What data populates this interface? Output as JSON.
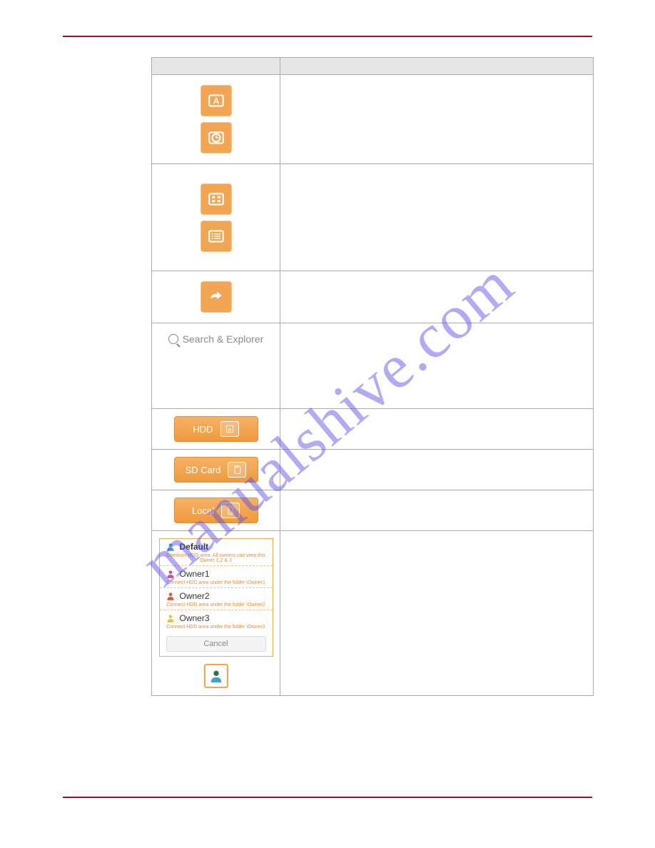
{
  "watermark": "manualshive.com",
  "table": {
    "rows": [
      {
        "id": "sort-name-date",
        "desc": ""
      },
      {
        "id": "view-grid-list",
        "desc": ""
      },
      {
        "id": "share",
        "desc": ""
      },
      {
        "id": "search",
        "search_text": "Search & Explorer",
        "desc": ""
      },
      {
        "id": "hdd",
        "label": "HDD",
        "desc": ""
      },
      {
        "id": "sdcard",
        "label": "SD Card",
        "desc": ""
      },
      {
        "id": "local",
        "label": "Local",
        "desc": ""
      },
      {
        "id": "owners",
        "desc": ""
      }
    ]
  },
  "owners": {
    "items": [
      {
        "name": "Default",
        "sub": "Common HDD area. All owners can view this Owner 1,2 & 3",
        "color": "#3aa6d0"
      },
      {
        "name": "Owner1",
        "sub": "Connect HDD area under the folder \\Owner1",
        "color": "#d34a93"
      },
      {
        "name": "Owner2",
        "sub": "Connect HDD area under the folder \\Owner2",
        "color": "#d85a3f"
      },
      {
        "name": "Owner3",
        "sub": "Connect HDD area under the folder \\Owner3",
        "color": "#e6c24a"
      }
    ],
    "cancel": "Cancel"
  }
}
